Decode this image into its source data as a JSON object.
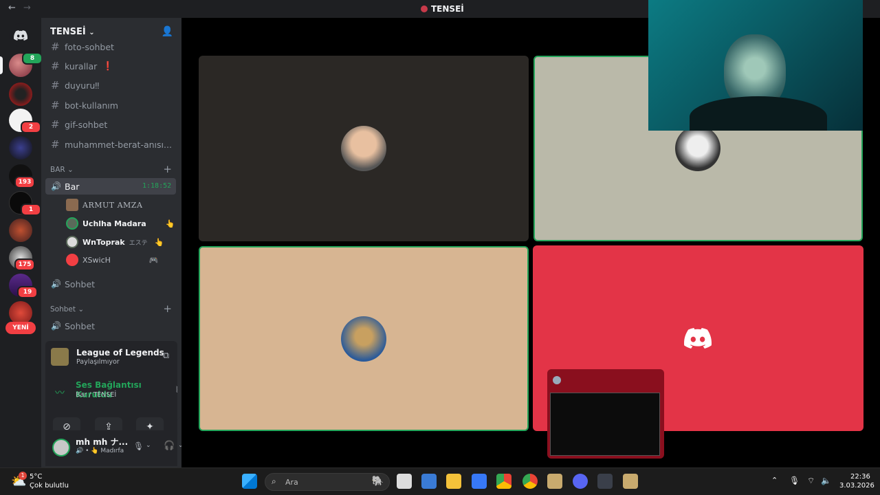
{
  "window": {
    "title": "TENSEİ",
    "back": "←",
    "forward": "→"
  },
  "server": {
    "name": "TENSEİ"
  },
  "rail": {
    "badges": [
      "8",
      "2",
      "193",
      "1",
      "175",
      "19"
    ],
    "new_label": "YENİ"
  },
  "channels": {
    "text": [
      {
        "name": "foto-sohbet"
      },
      {
        "name": "kurallar",
        "suffix": "❗"
      },
      {
        "name": "duyuru‼"
      },
      {
        "name": "bot-kullanım"
      },
      {
        "name": "gif-sohbet"
      },
      {
        "name": "muhammet-berat-anısı..."
      }
    ],
    "category_bar": "BAR",
    "voice_active": {
      "name": "Bar",
      "timer": "1:18:52"
    },
    "members": [
      {
        "name": "ARMUT AMZA"
      },
      {
        "name": "Uchlha Madara"
      },
      {
        "name": "WnToprak",
        "status": "エステ"
      },
      {
        "name": "XSwicH"
      }
    ],
    "voice_other": "Sohbet",
    "category_sohbet": "Sohbet",
    "voice_sohbet": "Sohbet"
  },
  "activity": {
    "game": "League of Legends",
    "status": "Paylaşılmıyor"
  },
  "voice": {
    "status": "Ses Bağlantısı Kuruldu",
    "location": "Bar / TENSEİ"
  },
  "user": {
    "name": "mh mh ナ...",
    "status": "Madırfa"
  },
  "taskbar": {
    "weather_badge": "1",
    "temp": "5°C",
    "weather": "Çok bulutlu",
    "search_placeholder": "Ara",
    "time": "22:36",
    "date": "3.03.2026"
  },
  "colors": {
    "discord_blurple": "#5865f2",
    "speaking_green": "#23a55a",
    "tile_red": "#e33447",
    "tile_tan": "#d7b592",
    "tile_grey": "#bab9a9",
    "tile_dark": "#2b2825"
  }
}
